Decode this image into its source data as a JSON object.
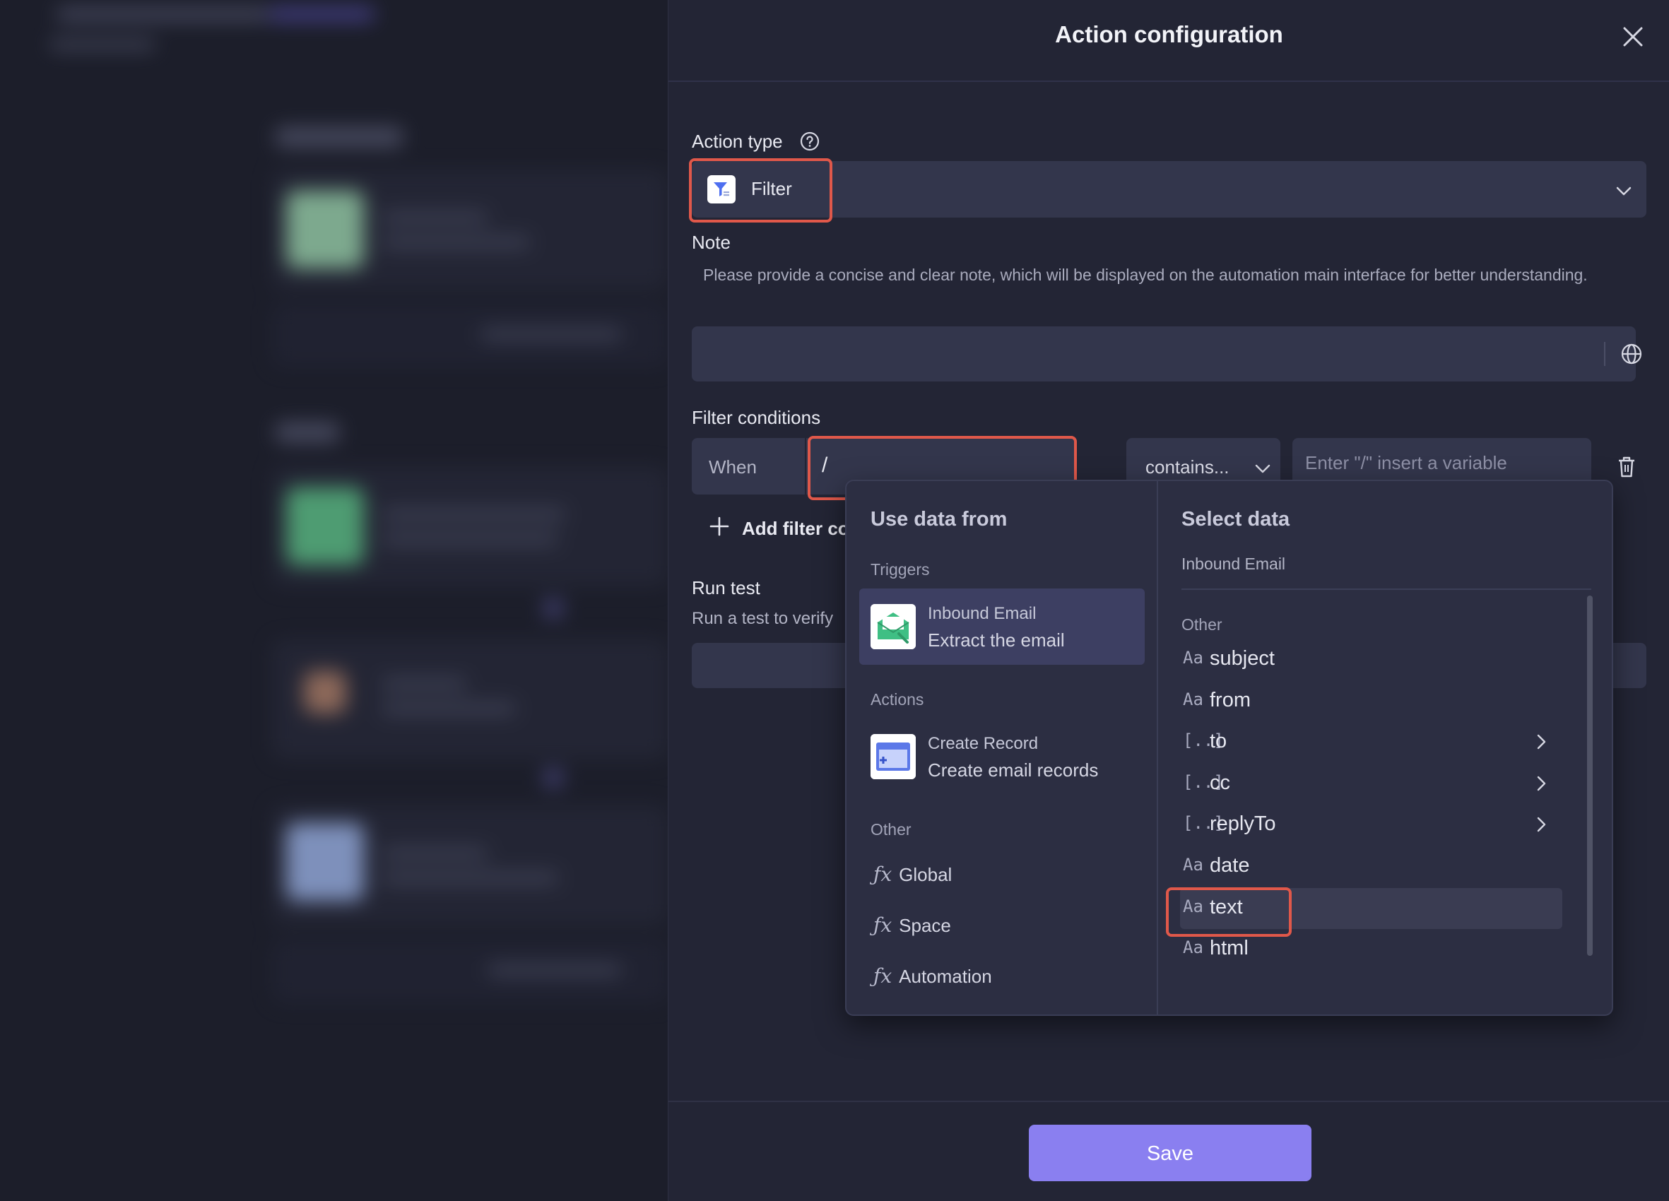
{
  "drawer": {
    "title": "Action configuration"
  },
  "action_type": {
    "label": "Action type",
    "value": "Filter"
  },
  "note": {
    "label": "Note",
    "hint": "Please provide a concise and clear note, which will be displayed on the automation main interface for better understanding.",
    "value": ""
  },
  "filter": {
    "label": "Filter conditions",
    "when_label": "When",
    "input_value": "/",
    "operator": "contains...",
    "value_placeholder": "Enter \"/\" insert a variable",
    "add_label": "Add filter co"
  },
  "run_test": {
    "label": "Run test",
    "hint": "Run a test to verify"
  },
  "popover": {
    "left_heading": "Use data from",
    "groups": {
      "triggers": "Triggers",
      "actions": "Actions",
      "other": "Other"
    },
    "trigger_item": {
      "title": "Inbound Email",
      "subtitle": "Extract the email"
    },
    "action_item": {
      "title": "Create Record",
      "subtitle": "Create email records"
    },
    "other_items": [
      "Global",
      "Space",
      "Automation"
    ],
    "right_heading": "Select data",
    "source_name": "Inbound Email",
    "right_group": "Other",
    "fields": [
      {
        "type": "Aa",
        "name": "subject",
        "expandable": false
      },
      {
        "type": "[..]",
        "name": "from",
        "expandable": false
      },
      {
        "type": "[..]",
        "name": "to",
        "expandable": true
      },
      {
        "type": "[..]",
        "name": "cc",
        "expandable": true
      },
      {
        "type": "[..]",
        "name": "replyTo",
        "expandable": true
      },
      {
        "type": "Aa",
        "name": "date",
        "expandable": false
      },
      {
        "type": "Aa",
        "name": "text",
        "expandable": false
      },
      {
        "type": "Aa",
        "name": "html",
        "expandable": false
      }
    ]
  },
  "footer": {
    "save_label": "Save"
  },
  "colors": {
    "accent": "#8a7ff0",
    "highlight": "#e0584a",
    "panel": "#232535"
  }
}
